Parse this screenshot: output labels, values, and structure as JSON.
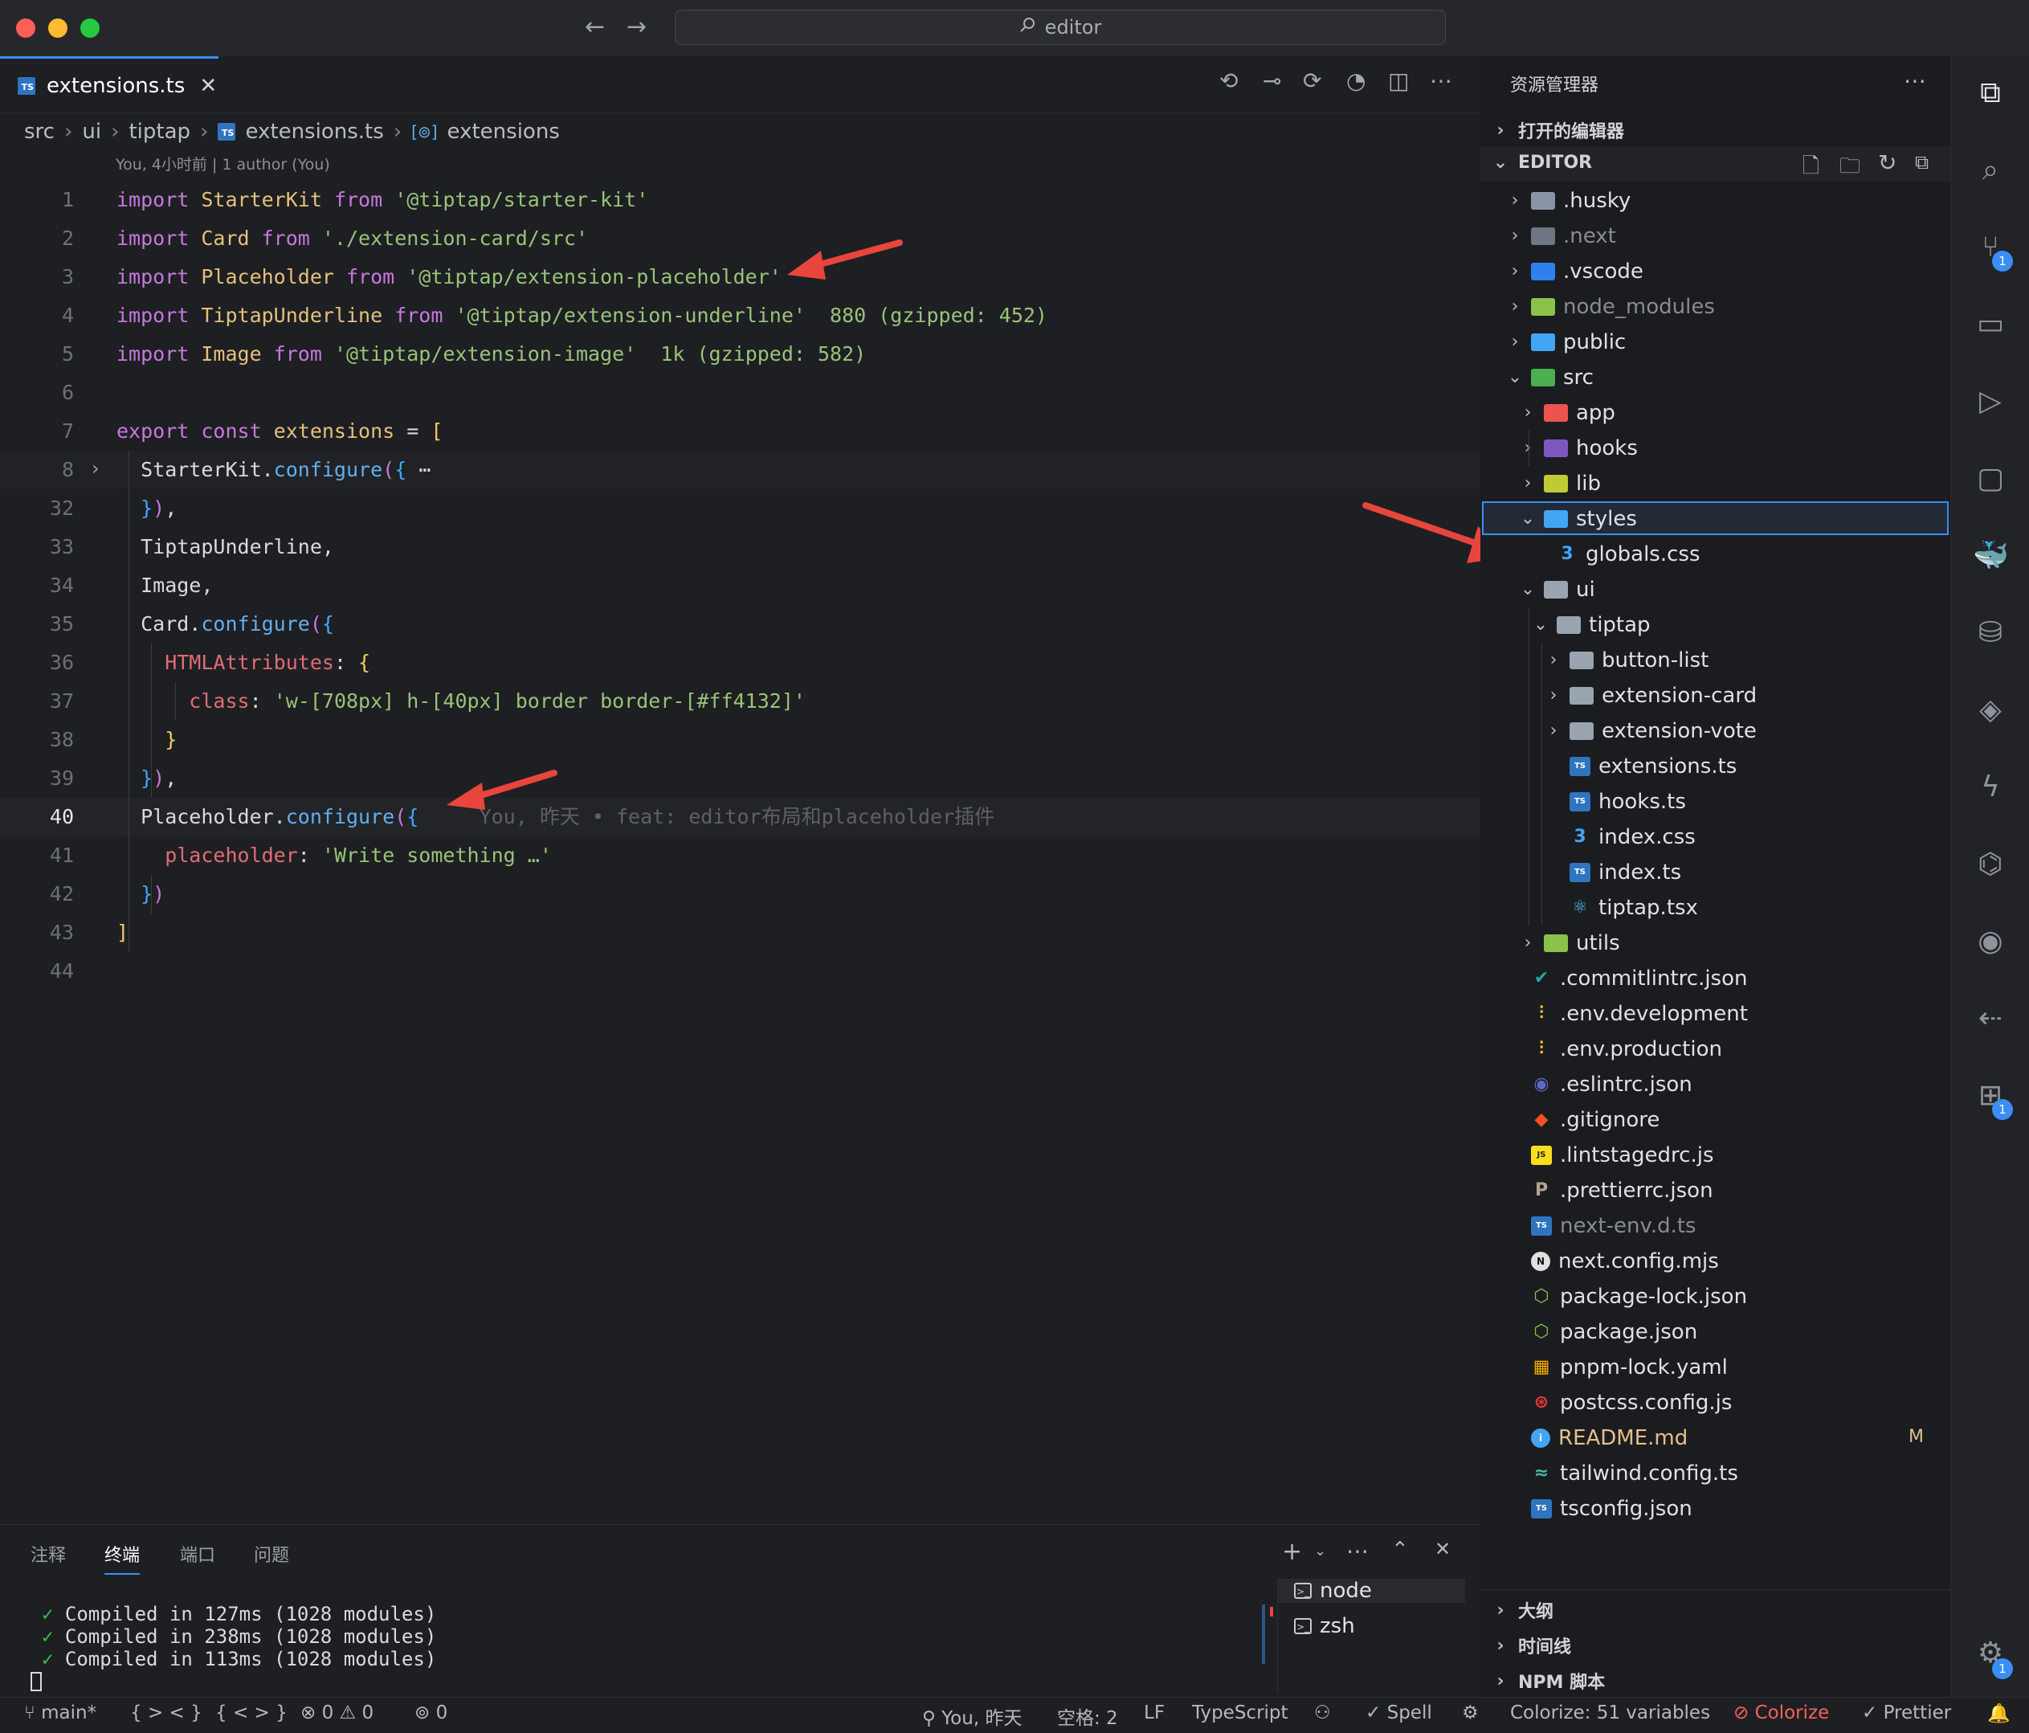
{
  "window": {
    "search_title": "editor"
  },
  "tab": {
    "label": "extensions.ts",
    "badge": "TS"
  },
  "breadcrumb": [
    "src",
    "ui",
    "tiptap",
    "extensions.ts",
    "extensions"
  ],
  "blame_header": "You, 4小时前 | 1 author (You)",
  "code_lines": [
    {
      "n": "1",
      "parts": [
        [
          "kw",
          "import "
        ],
        [
          "cls",
          "StarterKit "
        ],
        [
          "kw",
          "from "
        ],
        [
          "str",
          "'@tiptap/starter-kit'"
        ]
      ]
    },
    {
      "n": "2",
      "parts": [
        [
          "kw",
          "import "
        ],
        [
          "cls",
          "Card "
        ],
        [
          "kw",
          "from "
        ],
        [
          "str",
          "'./extension-card/src'"
        ]
      ]
    },
    {
      "n": "3",
      "parts": [
        [
          "kw",
          "import "
        ],
        [
          "cls",
          "Placeholder "
        ],
        [
          "kw",
          "from "
        ],
        [
          "str",
          "'@tiptap/extension-placeholder'"
        ]
      ]
    },
    {
      "n": "4",
      "parts": [
        [
          "kw",
          "import "
        ],
        [
          "cls",
          "TiptapUnderline "
        ],
        [
          "kw",
          "from "
        ],
        [
          "str",
          "'@tiptap/extension-underline'"
        ],
        [
          "hint",
          "  880 (gzipped: 452)"
        ]
      ]
    },
    {
      "n": "5",
      "parts": [
        [
          "kw",
          "import "
        ],
        [
          "cls",
          "Image "
        ],
        [
          "kw",
          "from "
        ],
        [
          "str",
          "'@tiptap/extension-image'"
        ],
        [
          "hint",
          "  1k (gzipped: 582)"
        ]
      ]
    },
    {
      "n": "6",
      "parts": []
    },
    {
      "n": "7",
      "parts": [
        [
          "kw",
          "export const "
        ],
        [
          "var",
          "extensions "
        ],
        [
          "plain",
          "= "
        ],
        [
          "brk1",
          "["
        ]
      ]
    },
    {
      "n": "8",
      "parts": [
        [
          "plain",
          "  StarterKit."
        ],
        [
          "fn",
          "configure"
        ],
        [
          "brk2",
          "("
        ],
        [
          "brk3",
          "{"
        ],
        [
          "plain",
          " ⋯"
        ]
      ]
    },
    {
      "n": "32",
      "parts": [
        [
          "brk3",
          "  }"
        ],
        [
          "brk2",
          ")"
        ],
        [
          "plain",
          ","
        ]
      ]
    },
    {
      "n": "33",
      "parts": [
        [
          "plain",
          "  TiptapUnderline,"
        ]
      ]
    },
    {
      "n": "34",
      "parts": [
        [
          "plain",
          "  Image,"
        ]
      ]
    },
    {
      "n": "35",
      "parts": [
        [
          "plain",
          "  Card."
        ],
        [
          "fn",
          "configure"
        ],
        [
          "brk2",
          "("
        ],
        [
          "brk3",
          "{"
        ]
      ]
    },
    {
      "n": "36",
      "parts": [
        [
          "prop",
          "    HTMLAttributes"
        ],
        [
          "plain",
          ": "
        ],
        [
          "brk1",
          "{"
        ]
      ]
    },
    {
      "n": "37",
      "parts": [
        [
          "prop",
          "      class"
        ],
        [
          "plain",
          ": "
        ],
        [
          "str",
          "'w-[708px] h-[40px] border border-[#ff4132]'"
        ]
      ]
    },
    {
      "n": "38",
      "parts": [
        [
          "brk1",
          "    }"
        ]
      ]
    },
    {
      "n": "39",
      "parts": [
        [
          "brk3",
          "  }"
        ],
        [
          "brk2",
          ")"
        ],
        [
          "plain",
          ","
        ]
      ]
    },
    {
      "n": "40",
      "parts": [
        [
          "plain",
          "  Placeholder."
        ],
        [
          "fn",
          "configure"
        ],
        [
          "brk2",
          "("
        ],
        [
          "brk3",
          "{"
        ],
        [
          "blame",
          "     You, 昨天 • feat: editor布局和placeholder插件"
        ]
      ]
    },
    {
      "n": "41",
      "parts": [
        [
          "prop",
          "    placeholder"
        ],
        [
          "plain",
          ": "
        ],
        [
          "str",
          "'Write something …'"
        ]
      ]
    },
    {
      "n": "42",
      "parts": [
        [
          "brk3",
          "  }"
        ],
        [
          "brk2",
          ")"
        ]
      ]
    },
    {
      "n": "43",
      "parts": [
        [
          "brk1",
          "]"
        ]
      ]
    },
    {
      "n": "44",
      "parts": []
    }
  ],
  "panel": {
    "tabs": [
      "注释",
      "终端",
      "端口",
      "问题"
    ],
    "terminal_lines": [
      "Compiled in 127ms (1028 modules)",
      "Compiled in 238ms (1028 modules)",
      "Compiled in 113ms (1028 modules)"
    ],
    "tick": "✓",
    "terminals": [
      "node",
      "zsh"
    ]
  },
  "explorer": {
    "title": "资源管理器",
    "open_editors": "打开的编辑器",
    "root": "EDITOR",
    "items": [
      {
        "label": ".husky",
        "depth": 0,
        "chev": "right",
        "icon": "folder",
        "color": "#8a94a6"
      },
      {
        "label": ".next",
        "depth": 0,
        "chev": "right",
        "icon": "folder",
        "color": "#6f7785",
        "dim": true
      },
      {
        "label": ".vscode",
        "depth": 0,
        "chev": "right",
        "icon": "folder",
        "color": "#2f80ed"
      },
      {
        "label": "node_modules",
        "depth": 0,
        "chev": "right",
        "icon": "folder",
        "color": "#8bc34a",
        "dim": true
      },
      {
        "label": "public",
        "depth": 0,
        "chev": "right",
        "icon": "folder",
        "color": "#42a5f5"
      },
      {
        "label": "src",
        "depth": 0,
        "chev": "down",
        "icon": "folder",
        "color": "#4caf50"
      },
      {
        "label": "app",
        "depth": 1,
        "chev": "right",
        "icon": "folder",
        "color": "#ef5350"
      },
      {
        "label": "hooks",
        "depth": 1,
        "chev": "right",
        "icon": "folder",
        "color": "#7e57c2"
      },
      {
        "label": "lib",
        "depth": 1,
        "chev": "right",
        "icon": "folder",
        "color": "#c0ca33"
      },
      {
        "label": "styles",
        "depth": 1,
        "chev": "down",
        "icon": "folder",
        "color": "#42a5f5",
        "selected": true
      },
      {
        "label": "globals.css",
        "depth": 2,
        "chev": "",
        "icon": "css",
        "color": "#42a5f5"
      },
      {
        "label": "ui",
        "depth": 1,
        "chev": "down",
        "icon": "folder",
        "color": "#9aa3b0"
      },
      {
        "label": "tiptap",
        "depth": 2,
        "chev": "down",
        "icon": "folder",
        "color": "#9aa3b0"
      },
      {
        "label": "button-list",
        "depth": 3,
        "chev": "right",
        "icon": "folder",
        "color": "#9aa3b0"
      },
      {
        "label": "extension-card",
        "depth": 3,
        "chev": "right",
        "icon": "folder",
        "color": "#9aa3b0"
      },
      {
        "label": "extension-vote",
        "depth": 3,
        "chev": "right",
        "icon": "folder",
        "color": "#9aa3b0"
      },
      {
        "label": "extensions.ts",
        "depth": 3,
        "chev": "",
        "icon": "ts",
        "color": "#2f74c0"
      },
      {
        "label": "hooks.ts",
        "depth": 3,
        "chev": "",
        "icon": "ts",
        "color": "#2f74c0"
      },
      {
        "label": "index.css",
        "depth": 3,
        "chev": "",
        "icon": "css",
        "color": "#42a5f5"
      },
      {
        "label": "index.ts",
        "depth": 3,
        "chev": "",
        "icon": "ts",
        "color": "#2f74c0"
      },
      {
        "label": "tiptap.tsx",
        "depth": 3,
        "chev": "",
        "icon": "react",
        "color": "#4fc3f7"
      },
      {
        "label": "utils",
        "depth": 1,
        "chev": "right",
        "icon": "folder",
        "color": "#8bc34a"
      },
      {
        "label": ".commitlintrc.json",
        "depth": 0,
        "chev": "",
        "icon": "check",
        "color": "#26a69a"
      },
      {
        "label": ".env.development",
        "depth": 0,
        "chev": "",
        "icon": "env",
        "color": "#fbc02d"
      },
      {
        "label": ".env.production",
        "depth": 0,
        "chev": "",
        "icon": "env",
        "color": "#fbc02d"
      },
      {
        "label": ".eslintrc.json",
        "depth": 0,
        "chev": "",
        "icon": "eslint",
        "color": "#5c6bc0"
      },
      {
        "label": ".gitignore",
        "depth": 0,
        "chev": "",
        "icon": "git",
        "color": "#f4511e"
      },
      {
        "label": ".lintstagedrc.js",
        "depth": 0,
        "chev": "",
        "icon": "js",
        "color": "#f7df1e"
      },
      {
        "label": ".prettierrc.json",
        "depth": 0,
        "chev": "",
        "icon": "prettier",
        "color": "#b0a68a"
      },
      {
        "label": "next-env.d.ts",
        "depth": 0,
        "chev": "",
        "icon": "ts",
        "color": "#2f74c0",
        "dim": true
      },
      {
        "label": "next.config.mjs",
        "depth": 0,
        "chev": "",
        "icon": "next",
        "color": "#e0e0e0"
      },
      {
        "label": "package-lock.json",
        "depth": 0,
        "chev": "",
        "icon": "node",
        "color": "#8bc34a"
      },
      {
        "label": "package.json",
        "depth": 0,
        "chev": "",
        "icon": "node",
        "color": "#8bc34a"
      },
      {
        "label": "pnpm-lock.yaml",
        "depth": 0,
        "chev": "",
        "icon": "pnpm",
        "color": "#f9ad00"
      },
      {
        "label": "postcss.config.js",
        "depth": 0,
        "chev": "",
        "icon": "postcss",
        "color": "#e53935"
      },
      {
        "label": "README.md",
        "depth": 0,
        "chev": "",
        "icon": "info",
        "color": "#42a5f5",
        "modified": true
      },
      {
        "label": "tailwind.config.ts",
        "depth": 0,
        "chev": "",
        "icon": "tailwind",
        "color": "#4db6ac"
      },
      {
        "label": "tsconfig.json",
        "depth": 0,
        "chev": "",
        "icon": "tsconfig",
        "color": "#2f74c0"
      }
    ],
    "modified_flag": "M",
    "bottom_sections": [
      "大纲",
      "时间线",
      "NPM 脚本"
    ]
  },
  "activity_badges": {
    "scm": "1",
    "extensions": "1",
    "settings": "1"
  },
  "statusbar": {
    "branch": "main*",
    "nav1": "{ > < }",
    "nav2": "{ < > }",
    "errors": "0",
    "warnings": "0",
    "ports": "0",
    "blame": "You, 昨天",
    "spaces": "空格: 2",
    "eol": "LF",
    "language": "TypeScript",
    "spell": "Spell",
    "colorize_vars": "Colorize: 51 variables",
    "colorize": "Colorize",
    "prettier": "Prettier"
  },
  "colors": {
    "accent": "#3a8ef6",
    "annotation_arrow": "#e8453c",
    "selection_border": "#3a8ef6"
  }
}
